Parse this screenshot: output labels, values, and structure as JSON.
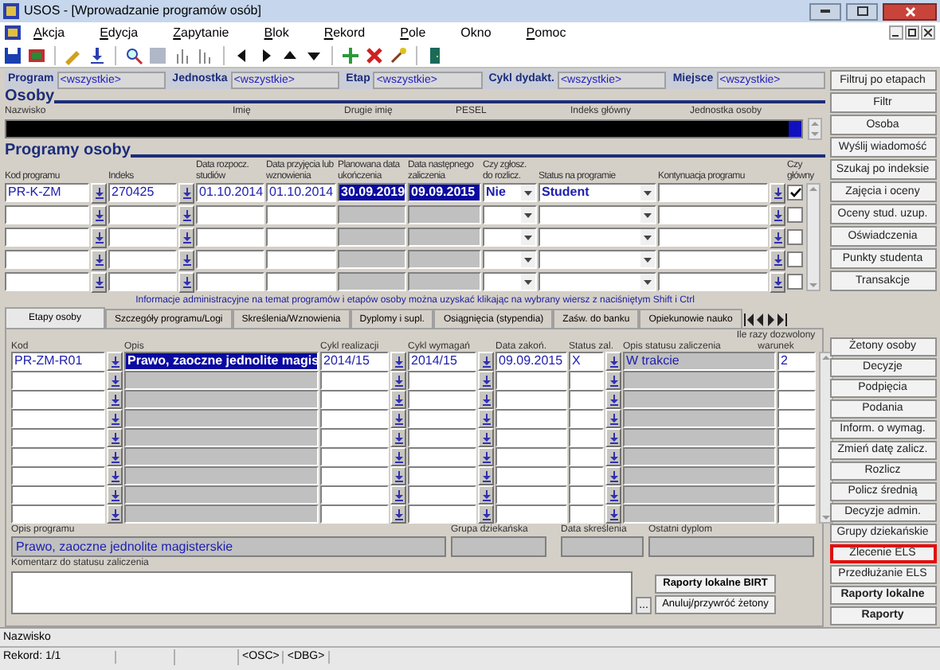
{
  "window": {
    "title": "USOS - [Wprowadzanie programów osób]"
  },
  "menu": [
    {
      "label": "Akcja",
      "mnemonic": true
    },
    {
      "label": "Edycja",
      "mnemonic": true
    },
    {
      "label": "Zapytanie",
      "mnemonic": true
    },
    {
      "label": "Blok",
      "mnemonic": true
    },
    {
      "label": "Rekord",
      "mnemonic": true
    },
    {
      "label": "Pole",
      "mnemonic": true
    },
    {
      "label": "Okno",
      "mnemonic": false
    },
    {
      "label": "Pomoc",
      "mnemonic": true
    }
  ],
  "filters": [
    {
      "label": "Program",
      "value": "<wszystkie>"
    },
    {
      "label": "Jednostka",
      "value": "<wszystkie>"
    },
    {
      "label": "Etap",
      "value": "<wszystkie>"
    },
    {
      "label": "Cykl dydakt.",
      "value": "<wszystkie>"
    },
    {
      "label": "Miejsce",
      "value": "<wszystkie>"
    }
  ],
  "osoby": {
    "title": "Osoby",
    "columns": [
      "Nazwisko",
      "Imię",
      "Drugie imię",
      "PESEL",
      "Indeks główny",
      "Jednostka osoby"
    ]
  },
  "programy": {
    "title": "Programy osoby",
    "columns": [
      "Kod programu",
      "Indeks",
      "Data rozpocz. studiów",
      "Data przyjęcia lub wznowienia",
      "Planowana data ukończenia",
      "Data następnego zaliczenia",
      "Czy zgłosz. do rozlicz.",
      "Status na programie",
      "Kontynuacja programu",
      "Czy główny"
    ],
    "rows": [
      {
        "kod": "PR-K-ZM",
        "indeks": "270425",
        "start": "01.10.2014",
        "przyjecie": "01.10.2014",
        "planowana": "30.09.2019",
        "nastepne": "09.09.2015",
        "zglosz": "Nie",
        "status": "Student",
        "main": true,
        "current": true
      },
      {
        "main": false,
        "current": false
      },
      {
        "main": false,
        "current": false
      },
      {
        "main": false,
        "current": false
      },
      {
        "main": false,
        "current": false
      }
    ]
  },
  "info": "Informacje administracyjne na temat programów i etapów osoby można uzyskać klikając na wybrany wiersz z naciśniętym Shift i Ctrl",
  "tabs": [
    {
      "label": "Etapy osoby",
      "selected": true
    },
    {
      "label": "Szczegóły programu/Logi",
      "selected": false
    },
    {
      "label": "Skreślenia/Wznowienia",
      "selected": false
    },
    {
      "label": "Dyplomy i supl.",
      "selected": false
    },
    {
      "label": "Osiągnięcia (stypendia)",
      "selected": false
    },
    {
      "label": "Zaśw. do banku",
      "selected": false
    },
    {
      "label": "Opiekunowie nauko",
      "selected": false
    }
  ],
  "etapy": {
    "columns": [
      "Kod",
      "Opis",
      "Cykl realizacji",
      "Cykl wymagań",
      "Data zakoń.",
      "Status zal.",
      "Opis statusu zaliczenia",
      "Ile razy dozwolony warunek"
    ],
    "rows": [
      {
        "kod": "PR-ZM-R01",
        "opis": "Prawo, zaoczne jednolite magis",
        "cykl_realizacji": "2014/15",
        "cykl_wymagan": "2014/15",
        "data": "09.09.2015",
        "status": "X",
        "opis_statusu": "W trakcie",
        "warunek": "2",
        "current": true
      }
    ]
  },
  "details": {
    "opis_label": "Opis programu",
    "opis": "Prawo, zaoczne jednolite magisterskie",
    "grupa_label": "Grupa dziekańska",
    "skreslenie_label": "Data skreślenia",
    "dyplom_label": "Ostatni dyplom",
    "komentarz_label": "Komentarz do statusu zaliczenia"
  },
  "more_button": "...",
  "bottom_buttons": [
    {
      "label": "Raporty lokalne BIRT",
      "bold": true
    },
    {
      "label": "Anuluj/przywróć żetony",
      "bold": false
    }
  ],
  "side_buttons_top": [
    {
      "label": "Filtruj po etapach",
      "bold": false,
      "outlined": false
    },
    {
      "label": "Filtr",
      "bold": false,
      "outlined": false
    },
    {
      "label": "Osoba",
      "bold": false,
      "outlined": false
    },
    {
      "label": "Wyślij wiadomość",
      "bold": false,
      "outlined": false
    },
    {
      "label": "Szukaj po indeksie",
      "bold": false,
      "outlined": false
    },
    {
      "label": "Zajęcia i oceny",
      "bold": false,
      "outlined": false
    },
    {
      "label": "Oceny stud. uzup.",
      "bold": false,
      "outlined": false
    },
    {
      "label": "Oświadczenia",
      "bold": false,
      "outlined": false
    },
    {
      "label": "Punkty studenta",
      "bold": false,
      "outlined": false
    },
    {
      "label": "Transakcje",
      "bold": false,
      "outlined": false
    }
  ],
  "side_buttons_bottom": [
    {
      "label": "Żetony osoby",
      "bold": false,
      "outlined": false
    },
    {
      "label": "Decyzje",
      "bold": false,
      "outlined": false
    },
    {
      "label": "Podpięcia",
      "bold": false,
      "outlined": false
    },
    {
      "label": "Podania",
      "bold": false,
      "outlined": false
    },
    {
      "label": "Inform. o wymag.",
      "bold": false,
      "outlined": false
    },
    {
      "label": "Zmień datę zalicz.",
      "bold": false,
      "outlined": false
    },
    {
      "label": "Rozlicz",
      "bold": false,
      "outlined": false
    },
    {
      "label": "Policz średnią",
      "bold": false,
      "outlined": false
    },
    {
      "label": "Decyzje admin.",
      "bold": false,
      "outlined": false
    },
    {
      "label": "Grupy dziekańskie",
      "bold": false,
      "outlined": false
    },
    {
      "label": "Zlecenie ELS",
      "bold": false,
      "outlined": true
    },
    {
      "label": "Przedłużanie ELS",
      "bold": false,
      "outlined": false
    },
    {
      "label": "Raporty lokalne",
      "bold": true,
      "outlined": false
    },
    {
      "label": "Raporty",
      "bold": true,
      "outlined": false
    }
  ],
  "status_bar": {
    "hint": "Nazwisko",
    "record": "Rekord: 1/1",
    "flags": [
      "<OSC>",
      "<DBG>"
    ]
  }
}
